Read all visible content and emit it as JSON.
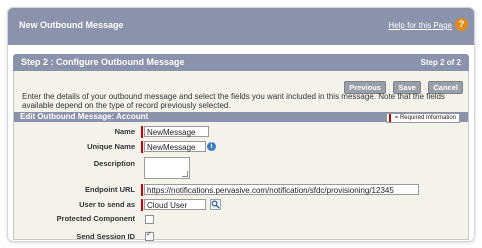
{
  "header": {
    "title": "New Outbound Message",
    "help_link": "Help for this Page",
    "help_icon": "help-icon"
  },
  "step": {
    "title": "Step 2 : Configure Outbound Message",
    "counter": "Step 2 of 2"
  },
  "buttons": {
    "previous": "Previous",
    "save": "Save",
    "cancel": "Cancel"
  },
  "intro": "Enter the details of your outbound message and select the fields you want included in this message. Note that the fields available depend on the type of record previously selected.",
  "section": {
    "title": "Edit Outbound Message: Account",
    "required_legend": "= Required Information"
  },
  "form": {
    "name": {
      "label": "Name",
      "value": "NewMessage"
    },
    "unique_name": {
      "label": "Unique Name",
      "value": "NewMessage"
    },
    "description": {
      "label": "Description",
      "value": ""
    },
    "endpoint_url": {
      "label": "Endpoint URL",
      "value": "https://notifications.pervasive.com/notification/sfdc/provisioning/12345"
    },
    "user_to_send_as": {
      "label": "User to send as",
      "value": "Cloud User"
    },
    "protected_component": {
      "label": "Protected Component",
      "checked": false
    },
    "send_session_id": {
      "label": "Send Session ID",
      "checked": true
    }
  },
  "colors": {
    "header": "#8a93ab",
    "required": "#cc0000",
    "help": "#e28b1c"
  }
}
